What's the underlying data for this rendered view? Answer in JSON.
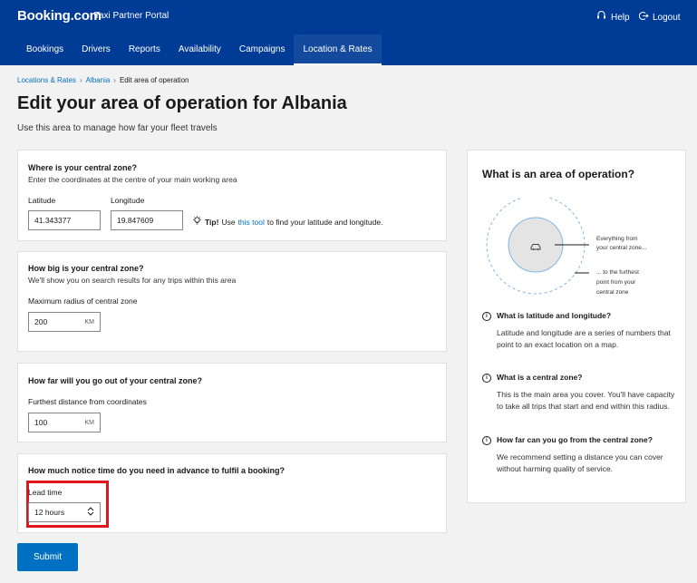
{
  "header": {
    "brand": "Booking.com",
    "portal": "Taxi Partner Portal",
    "help": "Help",
    "logout": "Logout"
  },
  "nav": {
    "items": [
      "Bookings",
      "Drivers",
      "Reports",
      "Availability",
      "Campaigns",
      "Location & Rates"
    ],
    "active": "Location & Rates"
  },
  "breadcrumb": {
    "items": [
      "Locations & Rates",
      "Albania",
      "Edit area of operation"
    ]
  },
  "page": {
    "title": "Edit your area of operation for Albania",
    "subtitle": "Use this area to manage how far your fleet travels"
  },
  "central_zone": {
    "title": "Where is your central zone?",
    "description": "Enter the coordinates at the centre of your main working area",
    "latitude_label": "Latitude",
    "latitude_value": "41.343377",
    "longitude_label": "Longitude",
    "longitude_value": "19.847609",
    "tip_bold": "Tip!",
    "tip_pre": "Use",
    "tip_link": "this tool",
    "tip_post": "to find your latitude and longitude."
  },
  "zone_size": {
    "title": "How big is your central zone?",
    "description": "We'll show you on search results for any trips within this area",
    "label": "Maximum radius of central zone",
    "value": "200",
    "unit": "KM"
  },
  "outside_zone": {
    "title": "How far will you go out of your central zone?",
    "label": "Furthest distance from coordinates",
    "value": "100",
    "unit": "KM"
  },
  "notice": {
    "title": "How much notice time do you need in advance to fulfil a booking?",
    "label": "Lead time",
    "value": "12 hours"
  },
  "submit_label": "Submit",
  "sidebar": {
    "title": "What is an area of operation?",
    "diagram": {
      "inner_label_1": "Everything from",
      "inner_label_2": "your central zone...",
      "outer_label_1": "... to the furthest",
      "outer_label_2": "point from your",
      "outer_label_3": "central zone"
    },
    "faqs": [
      {
        "q": "What is latitude and longitude?",
        "a": "Latitude and longitude are a series of numbers that point to an exact location on a map."
      },
      {
        "q": "What is a central zone?",
        "a": "This is the main area you cover. You'll have capacity to take all trips that start and end within this radius."
      },
      {
        "q": "How far can you go from the central zone?",
        "a": "We recommend setting a distance you can cover without harming quality of service."
      }
    ]
  },
  "colors": {
    "header": "#003b95",
    "link": "#0071c2",
    "button": "#0071c2",
    "highlight": "#e3141b"
  }
}
